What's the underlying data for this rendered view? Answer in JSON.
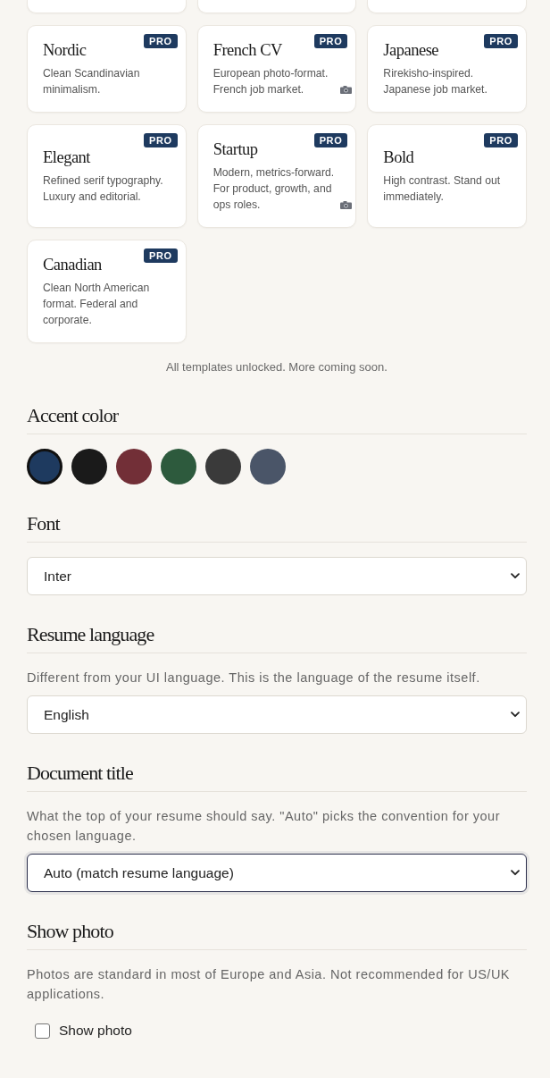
{
  "templates": [
    {
      "kind": "clipped"
    },
    {
      "kind": "clipped"
    },
    {
      "kind": "clipped"
    },
    {
      "kind": "card",
      "name": "Nordic",
      "badge": "PRO",
      "description": "Clean Scandinavian minimalism.",
      "photo_format": false
    },
    {
      "kind": "card",
      "name": "French CV",
      "badge": "PRO",
      "description": "European photo-format. French job market.",
      "photo_format": true
    },
    {
      "kind": "card",
      "name": "Japanese",
      "badge": "PRO",
      "description": "Rirekisho-inspired. Japanese job market.",
      "photo_format": false
    },
    {
      "kind": "card",
      "name": "Elegant",
      "badge": "PRO",
      "description": "Refined serif typography. Luxury and editorial.",
      "photo_format": false
    },
    {
      "kind": "card",
      "name": "Startup",
      "badge": "PRO",
      "description": "Modern, metrics-forward. For product, growth, and ops roles.",
      "photo_format": true
    },
    {
      "kind": "card",
      "name": "Bold",
      "badge": "PRO",
      "description": "High contrast. Stand out immediately.",
      "photo_format": false
    },
    {
      "kind": "card",
      "name": "Canadian",
      "badge": "PRO",
      "description": "Clean North American format. Federal and corporate.",
      "photo_format": false
    }
  ],
  "templates_note": "All templates unlocked. More coming soon.",
  "sections": [
    {
      "kind": "swatches",
      "heading": "Accent color",
      "swatches": [
        {
          "color": "#1e3a5f",
          "selected": true
        },
        {
          "color": "#1a1a1a",
          "selected": false
        },
        {
          "color": "#722f37",
          "selected": false
        },
        {
          "color": "#2d5a3d",
          "selected": false
        },
        {
          "color": "#3a3a3a",
          "selected": false
        },
        {
          "color": "#4a5568",
          "selected": false
        }
      ]
    },
    {
      "kind": "select",
      "heading": "Font",
      "value": "Inter",
      "focused": false
    },
    {
      "kind": "select",
      "heading": "Resume language",
      "hint": "Different from your UI language. This is the language of the resume itself.",
      "value": "English",
      "focused": false
    },
    {
      "kind": "select",
      "heading": "Document title",
      "hint": "What the top of your resume should say. \"Auto\" picks the convention for your chosen language.",
      "value": "Auto (match resume language)",
      "focused": true
    },
    {
      "kind": "checkbox",
      "heading": "Show photo",
      "hint": "Photos are standard in most of Europe and Asia. Not recommended for US/UK applications.",
      "label": "Show photo",
      "checked": false
    }
  ]
}
